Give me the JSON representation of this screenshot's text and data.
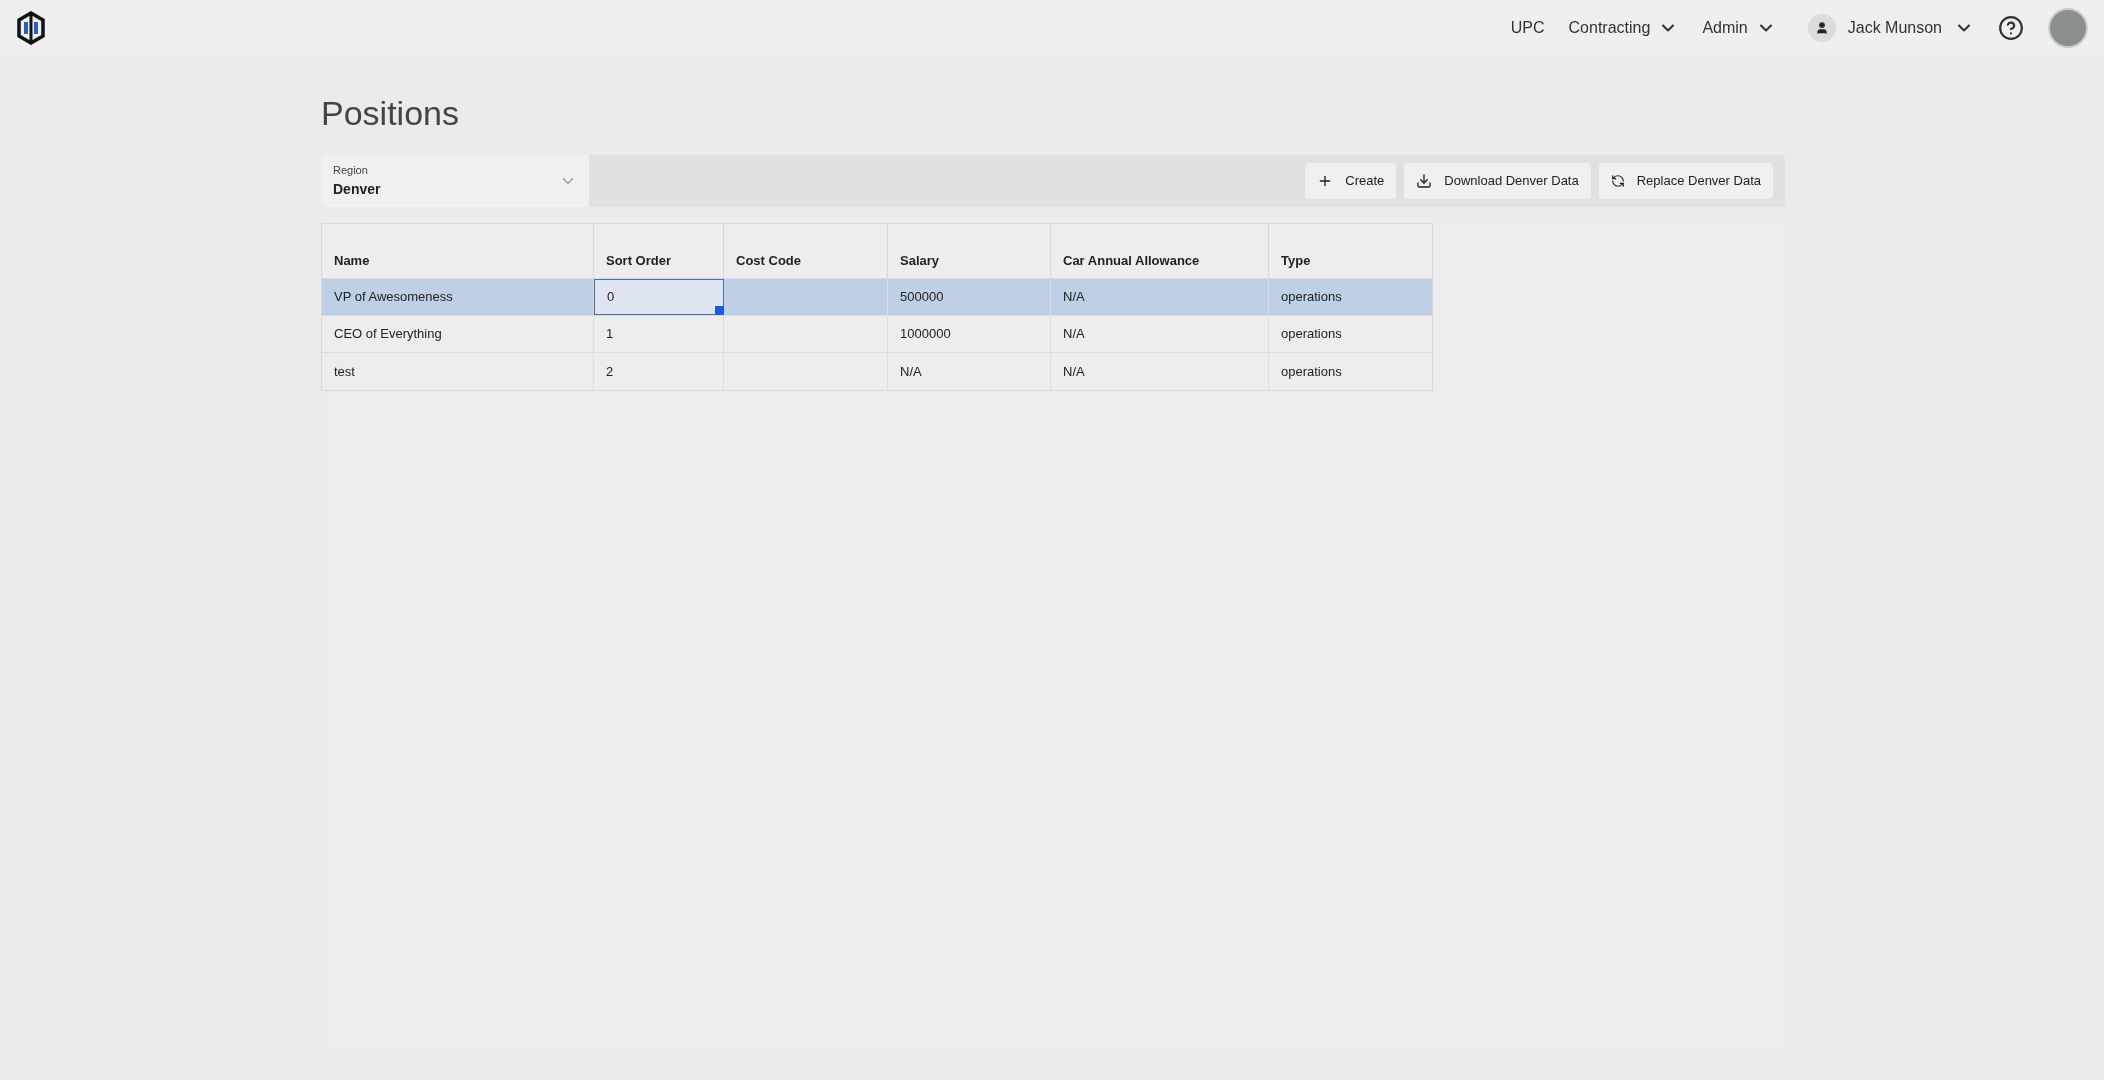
{
  "nav": {
    "items": [
      {
        "label": "UPC",
        "dropdown": false
      },
      {
        "label": "Contracting",
        "dropdown": true
      },
      {
        "label": "Admin",
        "dropdown": true
      }
    ],
    "user": {
      "name": "Jack Munson"
    }
  },
  "page": {
    "title": "Positions"
  },
  "toolbar": {
    "region": {
      "label": "Region",
      "value": "Denver"
    },
    "buttons": [
      {
        "label": "Create",
        "kind": "create"
      },
      {
        "label": "Download Denver Data",
        "kind": "download"
      },
      {
        "label": "Replace Denver Data",
        "kind": "replace"
      }
    ]
  },
  "table": {
    "columns": [
      "Name",
      "Sort Order",
      "Cost Code",
      "Salary",
      "Car Annual Allowance",
      "Type"
    ],
    "rows": [
      {
        "cells": [
          {
            "text": "VP of Awesomeness",
            "active": false
          },
          {
            "text": "0",
            "active": true
          },
          {
            "text": "",
            "active": false
          },
          {
            "text": "500000",
            "active": false
          },
          {
            "text": "N/A",
            "active": false
          },
          {
            "text": "operations",
            "active": false
          }
        ],
        "selected": true
      },
      {
        "cells": [
          {
            "text": "CEO of Everything",
            "active": false
          },
          {
            "text": "1",
            "active": false
          },
          {
            "text": "",
            "active": false
          },
          {
            "text": "1000000",
            "active": false
          },
          {
            "text": "N/A",
            "active": false
          },
          {
            "text": "operations",
            "active": false
          }
        ],
        "selected": false
      },
      {
        "cells": [
          {
            "text": "test",
            "active": false
          },
          {
            "text": "2",
            "active": false
          },
          {
            "text": "",
            "active": false
          },
          {
            "text": "N/A",
            "active": false
          },
          {
            "text": "N/A",
            "active": false
          },
          {
            "text": "operations",
            "active": false
          }
        ],
        "selected": false
      }
    ]
  }
}
